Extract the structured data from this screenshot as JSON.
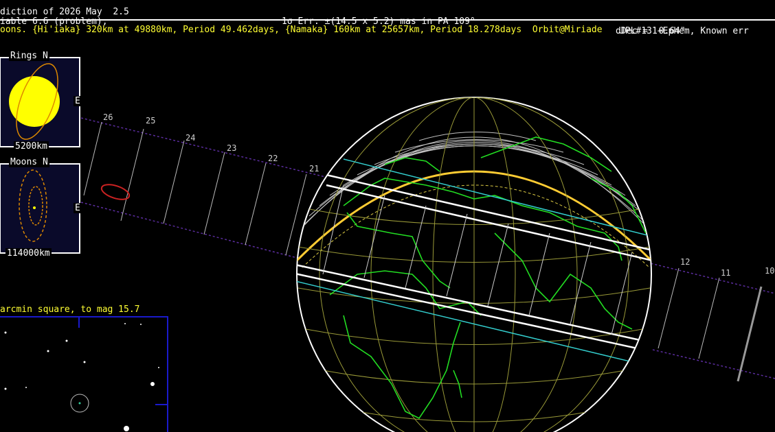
{
  "header": {
    "prediction": "diction of 2026 May  2.5",
    "error": "1σ Err: ±(14.5 x 5.2) mas in PA 109°",
    "ddec": "dDec =  0.64\"",
    "variable": "iable 6.6 (problem),",
    "ephem": "JPL#131+Ephem, Known err"
  },
  "moons_line": "oons. {Hi'iaka} 320km at 49880km, Period 49.462days, {Namaka} 160km at 25657km, Period 18.278days  Orbit@Miriade",
  "rings_panel": {
    "title": "Rings N",
    "east": "E",
    "scale": "5200km"
  },
  "moons_panel": {
    "title": "Moons N",
    "east": "E",
    "scale": "114000km"
  },
  "star_field": {
    "label": "arcmin square, to mag 15.7"
  },
  "path_ticks": [
    "26",
    "25",
    "24",
    "23",
    "22",
    "21",
    "12",
    "11",
    "10"
  ],
  "colors": {
    "background": "#000000",
    "header_text": "#ffffff",
    "info_text": "#ffff33",
    "coastline": "#22dd22",
    "grid": "#a0a040",
    "shadow_path": "#ffffff",
    "sigma_lines": "#33cccc",
    "track": "#6633aa",
    "body_disk": "#ffff00",
    "orbit": "#dd8800"
  }
}
